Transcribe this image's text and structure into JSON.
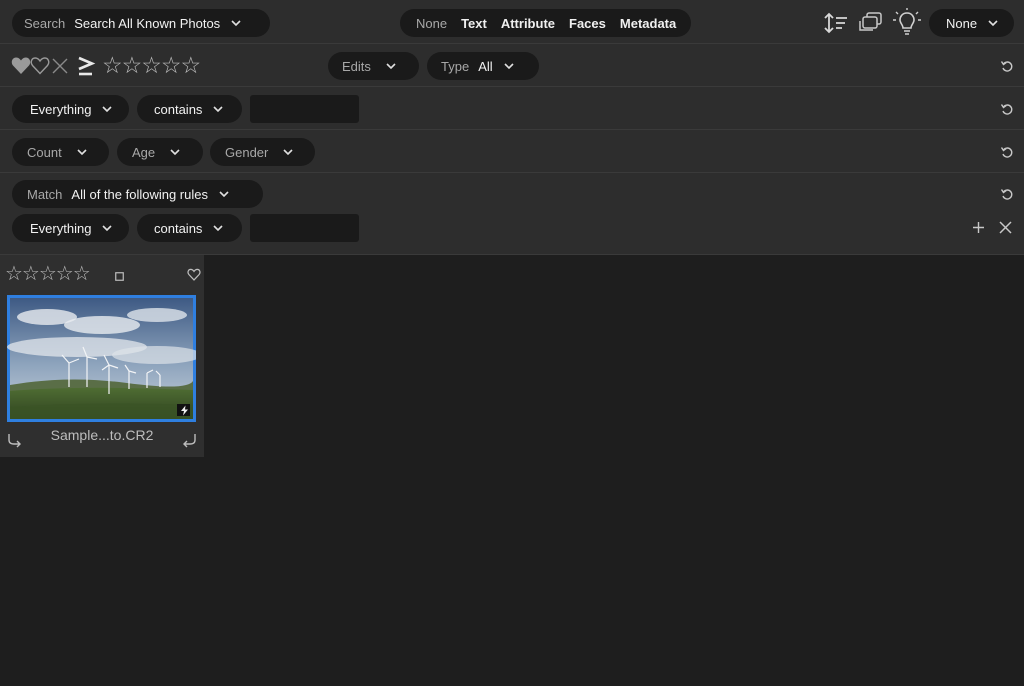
{
  "toolbar": {
    "search_label": "Search",
    "search_value": "Search All Known Photos",
    "modes": [
      "None",
      "Text",
      "Attribute",
      "Faces",
      "Metadata"
    ],
    "right_select": "None"
  },
  "filter_row": {
    "stars": "☆☆☆☆☆",
    "edits": "Edits",
    "type_label": "Type",
    "type_value": "All",
    "color_labels": [
      "#b65860",
      "#a7a04a",
      "#54944f",
      "#4b78a7",
      "#7a5d9a",
      "#3d3d3d"
    ]
  },
  "text_row": {
    "field_select": "Everything",
    "operator": "contains",
    "value": ""
  },
  "faces_row": {
    "count": "Count",
    "age": "Age",
    "gender": "Gender"
  },
  "metadata_row": {
    "match_label": "Match",
    "match_value": "All of the following rules",
    "rule_field": "Everything",
    "rule_operator": "contains",
    "rule_value": ""
  },
  "thumbnail": {
    "stars": "☆☆☆☆☆",
    "filename": "Sample...to.CR2"
  },
  "colors": {
    "accent": "#2f7fe0",
    "row_bg": "#2d2d2d",
    "pill_bg": "#1a1a1a",
    "canvas_bg": "#1e1e1e"
  },
  "icons": [
    "chevron-down-icon",
    "sort-icon",
    "stack-icon",
    "lightbulb-icon",
    "heart-icon",
    "reject-icon",
    "reset-icon",
    "plus-icon",
    "close-icon",
    "rotate-left-icon",
    "rotate-right-icon",
    "flash-icon",
    "checkbox-icon"
  ]
}
